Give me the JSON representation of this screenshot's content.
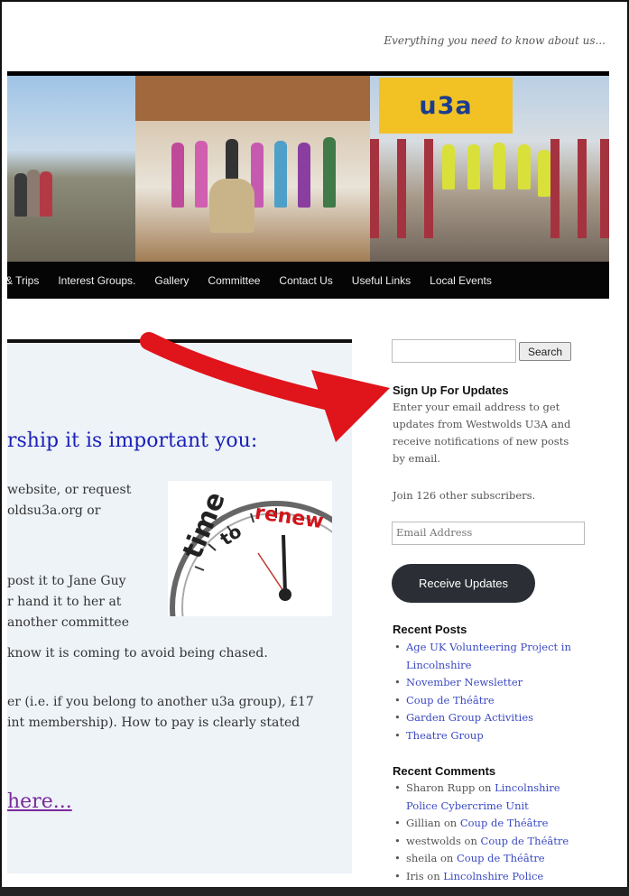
{
  "header": {
    "tagline": "Everything you need to know about us...",
    "banner_badge": "u3a"
  },
  "nav": {
    "items": [
      "& Trips",
      "Interest Groups.",
      "Gallery",
      "Committee",
      "Contact Us",
      "Useful Links",
      "Local Events"
    ]
  },
  "content": {
    "heading": "rship it is important you:",
    "lines": [
      "website, or request",
      "oldsu3a.org or",
      "post it to Jane Guy",
      "r hand it to her at",
      "another committee",
      "know it is coming to avoid being chased.",
      "er (i.e. if you belong to another u3a group), £17",
      "int membership). How to pay is clearly stated"
    ],
    "link": "here...",
    "image": {
      "word1": "time",
      "word2": "to",
      "word3": "renew"
    }
  },
  "sidebar": {
    "search_button": "Search",
    "signup": {
      "title": "Sign Up For Updates",
      "text": "Enter your email address to get updates from Westwolds U3A and receive notifications of new posts by email.",
      "subscribers": "Join 126 other subscribers.",
      "email_placeholder": "Email Address",
      "button": "Receive Updates"
    },
    "recent_posts": {
      "title": "Recent Posts",
      "items": [
        "Age UK Volunteering Project in Lincolnshire",
        "November Newsletter",
        "Coup de Théâtre",
        "Garden Group Activities",
        "Theatre Group"
      ]
    },
    "recent_comments": {
      "title": "Recent Comments",
      "items": [
        {
          "author": "Sharon Rupp",
          "on": "on",
          "post": "Lincolnshire Police Cybercrime Unit"
        },
        {
          "author": "Gillian",
          "on": "on",
          "post": "Coup de Théâtre"
        },
        {
          "author": "westwolds",
          "on": "on",
          "post": "Coup de Théâtre"
        },
        {
          "author": "sheila",
          "on": "on",
          "post": "Coup de Théâtre"
        },
        {
          "author": "Iris",
          "on": "on",
          "post": "Lincolnshire Police"
        }
      ]
    }
  },
  "colors": {
    "arrow": "#e0141b",
    "heading": "#1b20b8",
    "link": "#3b49c2",
    "badge": "#f2c224"
  }
}
